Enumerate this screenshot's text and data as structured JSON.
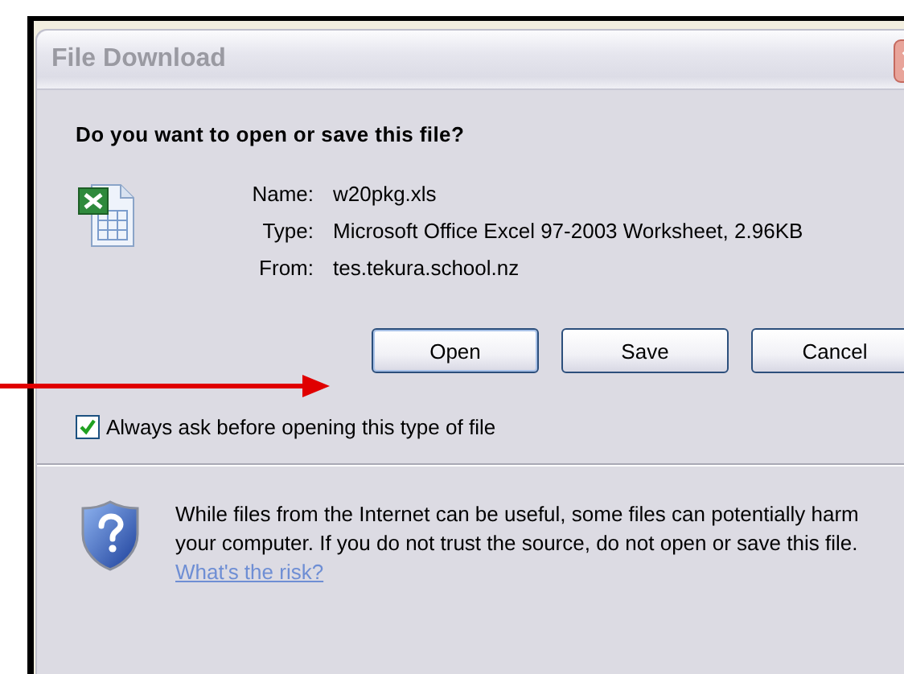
{
  "window": {
    "title": "File Download"
  },
  "question": "Do you want to open or save this file?",
  "details": [
    {
      "label": "Name:",
      "value": "w20pkg.xls"
    },
    {
      "label": "Type:",
      "value": "Microsoft Office Excel 97-2003 Worksheet, 2.96KB"
    },
    {
      "label": "From:",
      "value": "tes.tekura.school.nz"
    }
  ],
  "buttons": [
    {
      "label": "Open",
      "kind": "open"
    },
    {
      "label": "Save",
      "kind": "save"
    },
    {
      "label": "Cancel",
      "kind": "cancel"
    }
  ],
  "always_ask": {
    "label": "Always ask before opening this type of file",
    "checked": true
  },
  "warning": {
    "text": "While files from the Internet can be useful, some files can potentially harm your computer. If you do not trust the source, do not open or save this file.",
    "link": "What's the risk?"
  }
}
